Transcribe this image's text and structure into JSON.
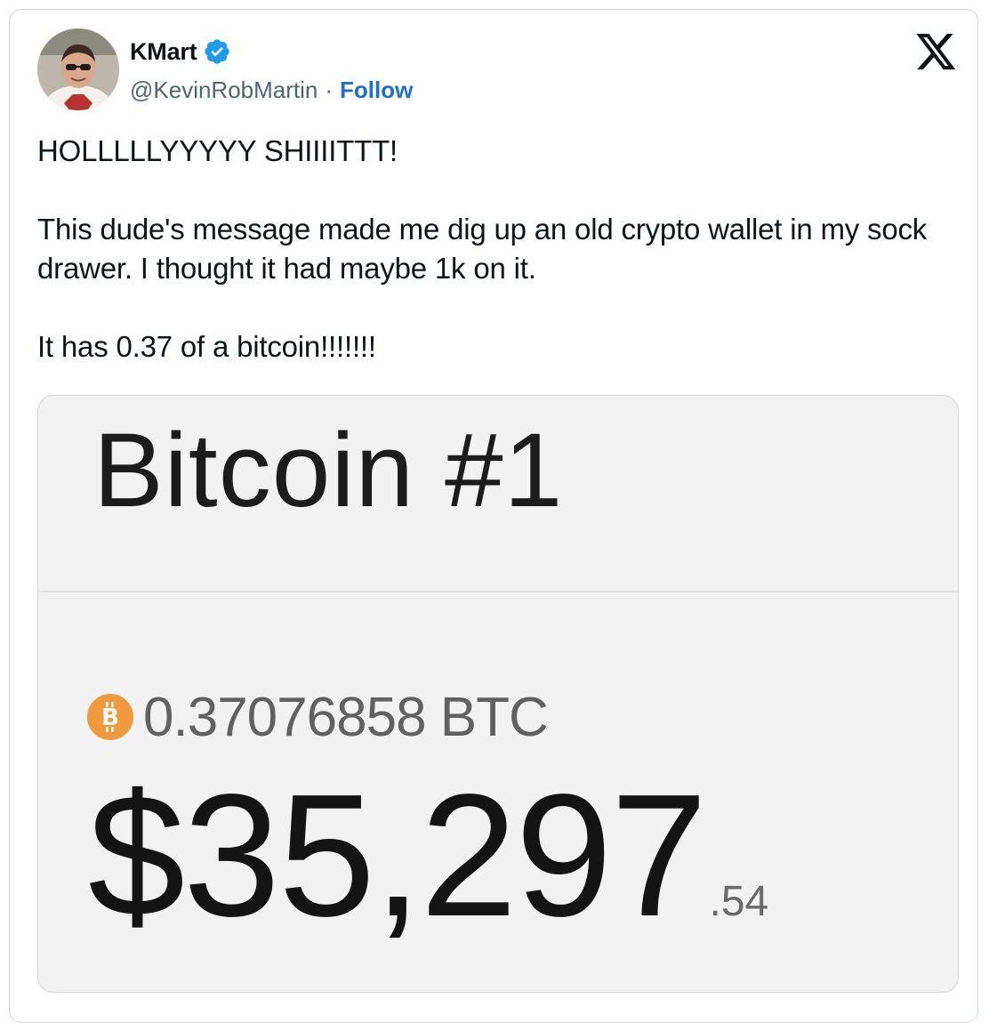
{
  "author": {
    "display_name": "KMart",
    "handle": "@KevinRobMartin",
    "separator": "·",
    "follow_label": "Follow",
    "verified_color": "#1d9bf0"
  },
  "tweet": {
    "line1": "HOLLLLLYYYYY SHIIIITTT!",
    "line2": "This dude's message made me dig up an old crypto wallet in my sock drawer. I thought it had maybe 1k on it.",
    "line3": "It has 0.37 of a bitcoin!!!!!!!"
  },
  "media": {
    "wallet_title": "Bitcoin #1",
    "btc_amount": "0.37076858 BTC",
    "usd_main": "$35,297",
    "usd_cents": ".54",
    "btc_icon_color": "#f09a3e",
    "btc_icon": "bitcoin-icon"
  },
  "platform_icon": "x-logo-icon",
  "colors": {
    "link": "#1d6fd0",
    "secondary_text": "#536471",
    "border": "#cfd9de"
  }
}
